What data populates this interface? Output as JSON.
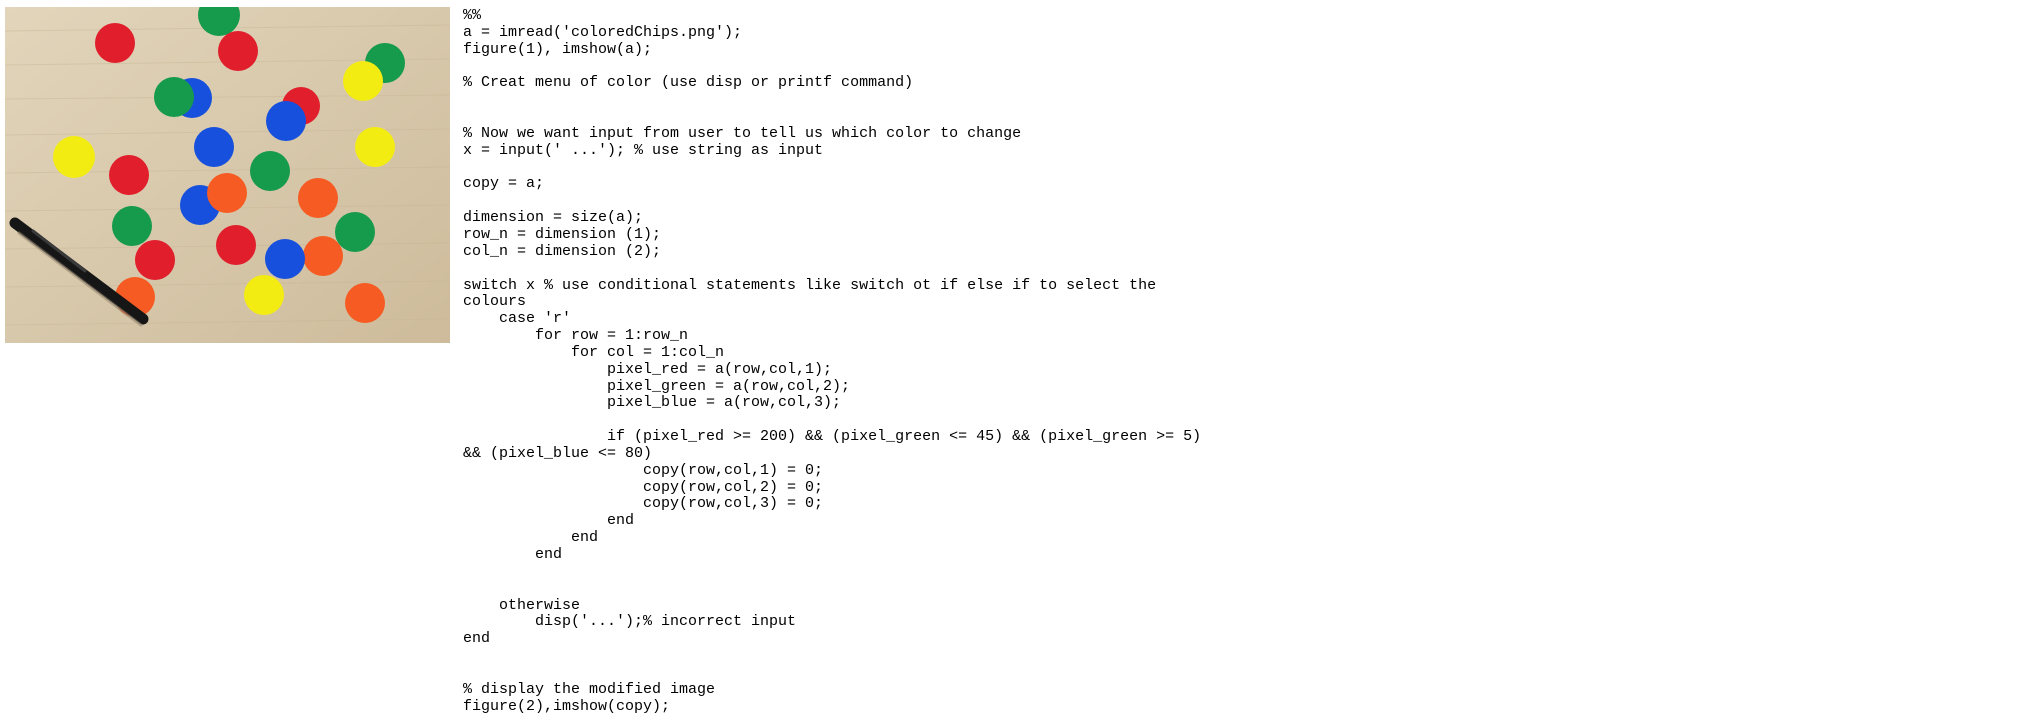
{
  "image": {
    "icon": "colored-chips-photo",
    "chip_colors": {
      "red": "#e11e2c",
      "green": "#169a4b",
      "blue": "#1650dd",
      "yellow": "#f3ec13",
      "orange": "#f55b22"
    },
    "pen_color": "#161616",
    "table_color": "#d9c9ac"
  },
  "code": {
    "lines": [
      "%%",
      "a = imread('coloredChips.png');",
      "figure(1), imshow(a);",
      "",
      "% Creat menu of color (use disp or printf command)",
      "",
      "",
      "% Now we want input from user to tell us which color to change",
      "x = input(' ...'); % use string as input",
      "",
      "copy = a;",
      "",
      "dimension = size(a);",
      "row_n = dimension (1);",
      "col_n = dimension (2);",
      "",
      "switch x % use conditional statements like switch ot if else if to select the",
      "colours",
      "    case 'r'",
      "        for row = 1:row_n",
      "            for col = 1:col_n",
      "                pixel_red = a(row,col,1);",
      "                pixel_green = a(row,col,2);",
      "                pixel_blue = a(row,col,3);",
      "",
      "                if (pixel_red >= 200) && (pixel_green <= 45) && (pixel_green >= 5)",
      "&& (pixel_blue <= 80)",
      "                    copy(row,col,1) = 0;",
      "                    copy(row,col,2) = 0;",
      "                    copy(row,col,3) = 0;",
      "                end",
      "            end",
      "        end",
      "",
      "",
      "    otherwise",
      "        disp('...');% incorrect input",
      "end",
      "",
      "",
      "% display the modified image",
      "figure(2),imshow(copy);"
    ]
  }
}
